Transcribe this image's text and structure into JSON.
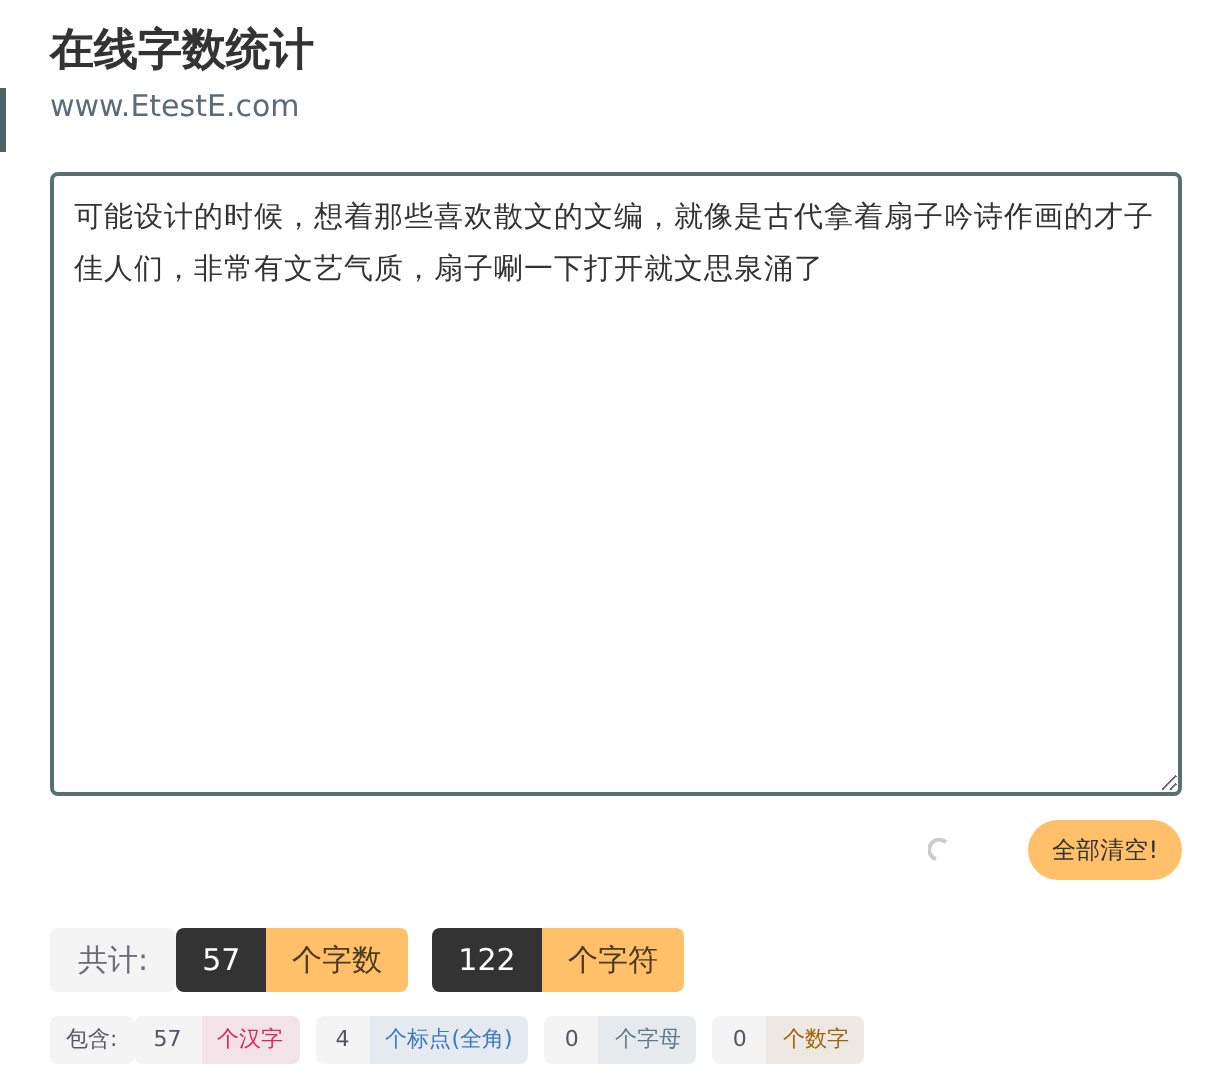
{
  "header": {
    "title": "在线字数统计",
    "subtitle": "www.EtestE.com"
  },
  "editor": {
    "value": "可能设计的时候，想着那些喜欢散文的文编，就像是古代拿着扇子吟诗作画的才子佳人们，非常有文艺气质，扇子唰一下打开就文思泉涌了"
  },
  "clear_button": "全部清空!",
  "totals": {
    "label": "共计:",
    "items": [
      {
        "count": "57",
        "unit": "个字数"
      },
      {
        "count": "122",
        "unit": "个字符"
      }
    ]
  },
  "details": {
    "label": "包含:",
    "items": [
      {
        "count": "57",
        "unit": "个汉字",
        "color": "#e0245e"
      },
      {
        "count": "4",
        "unit": "个标点(全角)",
        "color": "#3a7bbf"
      },
      {
        "count": "0",
        "unit": "个字母",
        "color": "#5f7a8c"
      },
      {
        "count": "0",
        "unit": "个数字",
        "color": "#a0640a"
      }
    ]
  }
}
